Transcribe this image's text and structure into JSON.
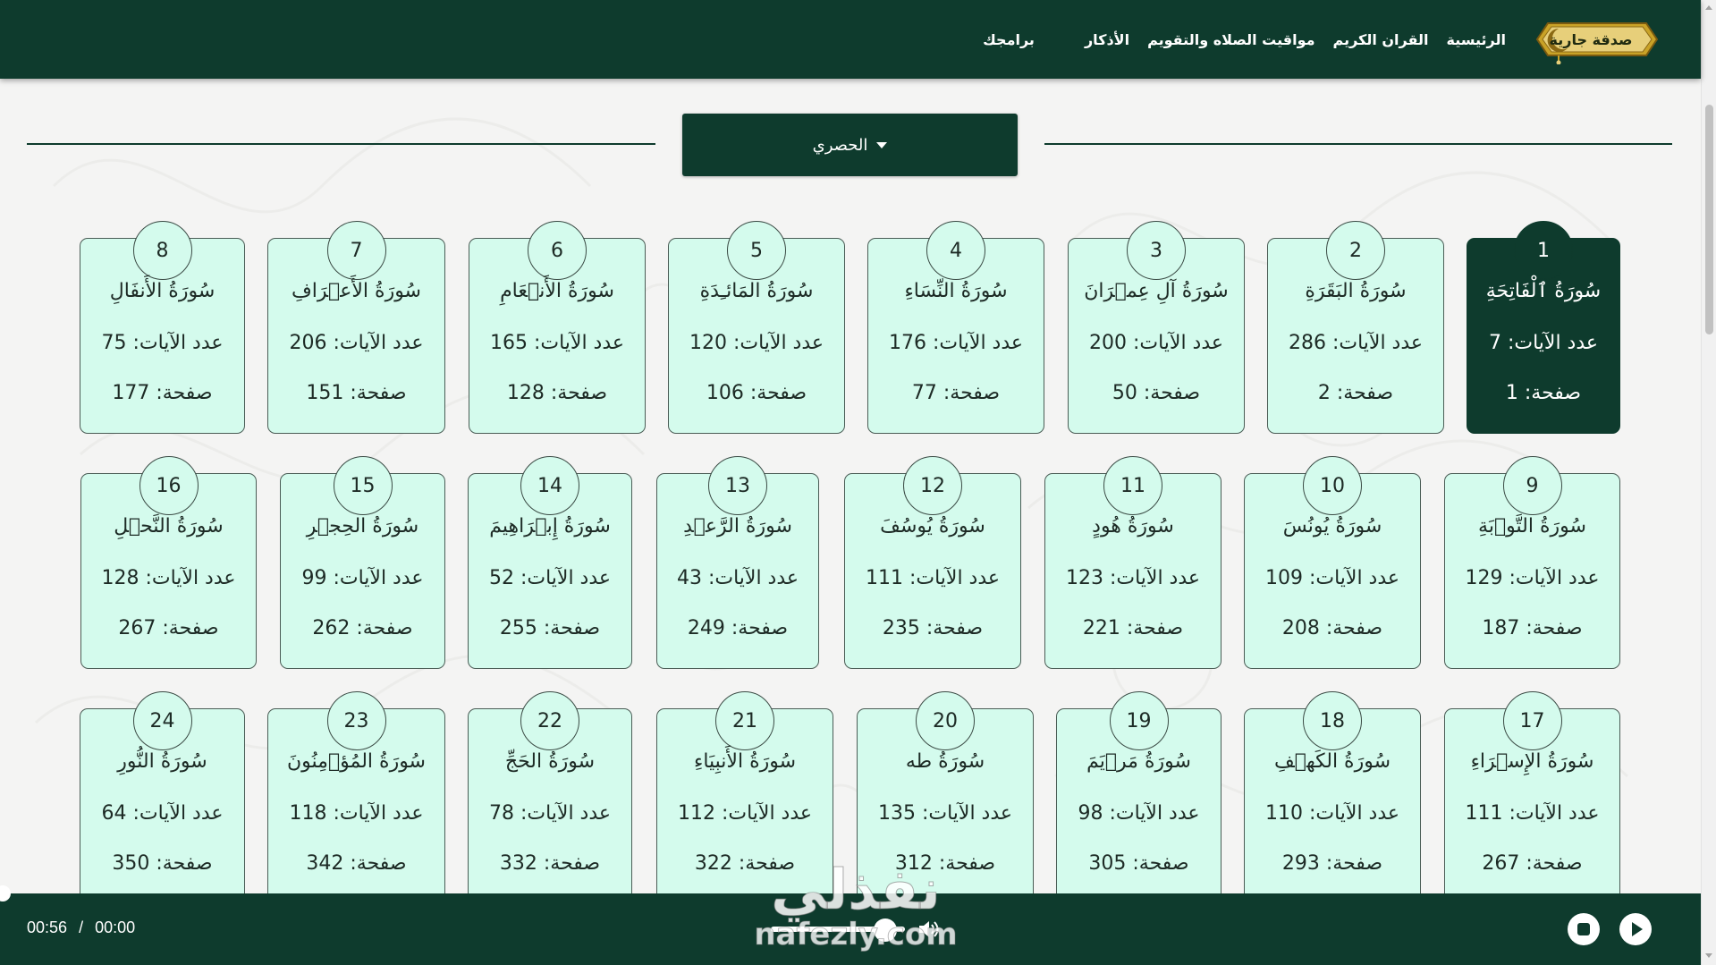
{
  "colors": {
    "primary": "#0e3b2d",
    "card": "#d4fbed",
    "logo_gold": "#c9a227"
  },
  "header": {
    "logo_text": "صدقة جارية",
    "nav": [
      "الرئيسية",
      "القران الكريم",
      "مواقيت الصلاه والتقويم",
      "الأذكار",
      "برامجك"
    ]
  },
  "reciter": {
    "selected": "الحصري"
  },
  "labels": {
    "ayat_prefix": "عدد الآيات: ",
    "page_prefix": "صفحة: "
  },
  "surahs": [
    {
      "number": 1,
      "name": "سُورَةُ ٱلْفَاتِحَةِ",
      "ayat": 7,
      "page": 1,
      "active": true
    },
    {
      "number": 2,
      "name": "سُورَةُ البَقَرَةِ",
      "ayat": 286,
      "page": 2
    },
    {
      "number": 3,
      "name": "سُورَةُ آلِ عِمۡرَانَ",
      "ayat": 200,
      "page": 50
    },
    {
      "number": 4,
      "name": "سُورَةُ النِّسَاءِ",
      "ayat": 176,
      "page": 77
    },
    {
      "number": 5,
      "name": "سُورَةُ المَائـِدَةِ",
      "ayat": 120,
      "page": 106
    },
    {
      "number": 6,
      "name": "سُورَةُ الأَنۡعَامِ",
      "ayat": 165,
      "page": 128
    },
    {
      "number": 7,
      "name": "سُورَةُ الأَعۡرَافِ",
      "ayat": 206,
      "page": 151
    },
    {
      "number": 8,
      "name": "سُورَةُ الأَنفَالِ",
      "ayat": 75,
      "page": 177
    },
    {
      "number": 9,
      "name": "سُورَةُ التَّوۡبَةِ",
      "ayat": 129,
      "page": 187
    },
    {
      "number": 10,
      "name": "سُورَةُ يُونُسَ",
      "ayat": 109,
      "page": 208
    },
    {
      "number": 11,
      "name": "سُورَةُ هُودٍ",
      "ayat": 123,
      "page": 221
    },
    {
      "number": 12,
      "name": "سُورَةُ يُوسُفَ",
      "ayat": 111,
      "page": 235
    },
    {
      "number": 13,
      "name": "سُورَةُ الرَّعۡدِ",
      "ayat": 43,
      "page": 249
    },
    {
      "number": 14,
      "name": "سُورَةُ إِبۡرَاهِيمَ",
      "ayat": 52,
      "page": 255
    },
    {
      "number": 15,
      "name": "سُورَةُ الحِجۡرِ",
      "ayat": 99,
      "page": 262
    },
    {
      "number": 16,
      "name": "سُورَةُ النَّحۡلِ",
      "ayat": 128,
      "page": 267
    },
    {
      "number": 17,
      "name": "سُورَةُ الإِسۡرَاءِ",
      "ayat": 111,
      "page": 267
    },
    {
      "number": 18,
      "name": "سُورَةُ الكَهۡفِ",
      "ayat": 110,
      "page": 293
    },
    {
      "number": 19,
      "name": "سُورَةُ مَرۡيَمَ",
      "ayat": 98,
      "page": 305
    },
    {
      "number": 20,
      "name": "سُورَةُ طه",
      "ayat": 135,
      "page": 312
    },
    {
      "number": 21,
      "name": "سُورَةُ الأَنبِيَاءِ",
      "ayat": 112,
      "page": 322
    },
    {
      "number": 22,
      "name": "سُورَةُ الحَجِّ",
      "ayat": 78,
      "page": 332
    },
    {
      "number": 23,
      "name": "سُورَةُ المُؤۡمِنُونَ",
      "ayat": 118,
      "page": 342
    },
    {
      "number": 24,
      "name": "سُورَةُ النُّورِ",
      "ayat": 64,
      "page": 350
    }
  ],
  "player": {
    "current_time": "00:56",
    "separator": "/",
    "duration": "00:00",
    "volume": 0.85,
    "progress": 0
  },
  "watermark": {
    "line1": "نفذلي",
    "line2": "nafezly.com"
  }
}
